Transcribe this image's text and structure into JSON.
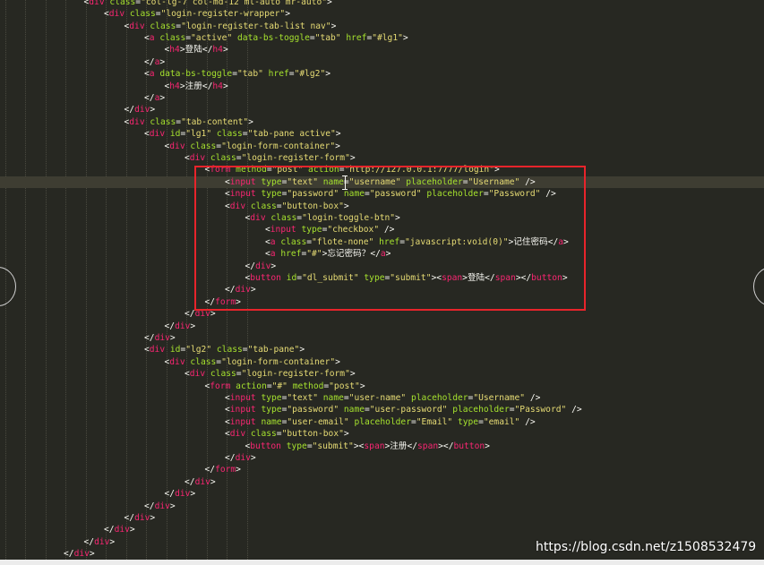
{
  "editor": {
    "lines": [
      "<div class=\"col-lg-7 col-md-12 ml-auto mr-auto\">",
      "<div class=\"login-register-wrapper\">",
      "<div class=\"login-register-tab-list nav\">",
      "<a class=\"active\" data-bs-toggle=\"tab\" href=\"#lg1\">",
      "<h4>登陆</h4>",
      "</a>",
      "<a data-bs-toggle=\"tab\" href=\"#lg2\">",
      "<h4>注册</h4>",
      "</a>",
      "</div>",
      "<div class=\"tab-content\">",
      "<div id=\"lg1\" class=\"tab-pane active\">",
      "<div class=\"login-form-container\">",
      "<div class=\"login-register-form\">",
      "<form method=\"post\" action=\"http://127.0.0.1:7777/login\">",
      "<input type=\"text\" name=\"username\" placeholder=\"Username\" />",
      "<input type=\"password\" name=\"password\" placeholder=\"Password\" />",
      "<div class=\"button-box\">",
      "<div class=\"login-toggle-btn\">",
      "<input type=\"checkbox\" />",
      "<a class=\"flote-none\" href=\"javascript:void(0)\">记住密码</a>",
      "<a href=\"#\">忘记密码？</a>",
      "</div>",
      "<button id=\"dl_submit\" type=\"submit\"><span>登陆</span></button>",
      "</div>",
      "</form>",
      "</div>",
      "</div>",
      "</div>",
      "<div id=\"lg2\" class=\"tab-pane\">",
      "<div class=\"login-form-container\">",
      "<div class=\"login-register-form\">",
      "<form action=\"#\" method=\"post\">",
      "<input type=\"text\" name=\"user-name\" placeholder=\"Username\" />",
      "<input type=\"password\" name=\"user-password\" placeholder=\"Password\" />",
      "<input name=\"user-email\" placeholder=\"Email\" type=\"email\" />",
      "<div class=\"button-box\">",
      "<button type=\"submit\"><span>注册</span></button>",
      "</div>",
      "</form>",
      "</div>",
      "</div>",
      "</div>",
      "</div>",
      "</div>",
      "</div>",
      "</div>"
    ],
    "current_line": 15
  },
  "watermark": "https://blog.csdn.net/z1508532479",
  "colors": {
    "background": "#272822",
    "tag": "#f92672",
    "attribute": "#a6e22e",
    "string": "#e6db74",
    "text": "#f8f8f2",
    "annotation_box": "#e8242b"
  }
}
